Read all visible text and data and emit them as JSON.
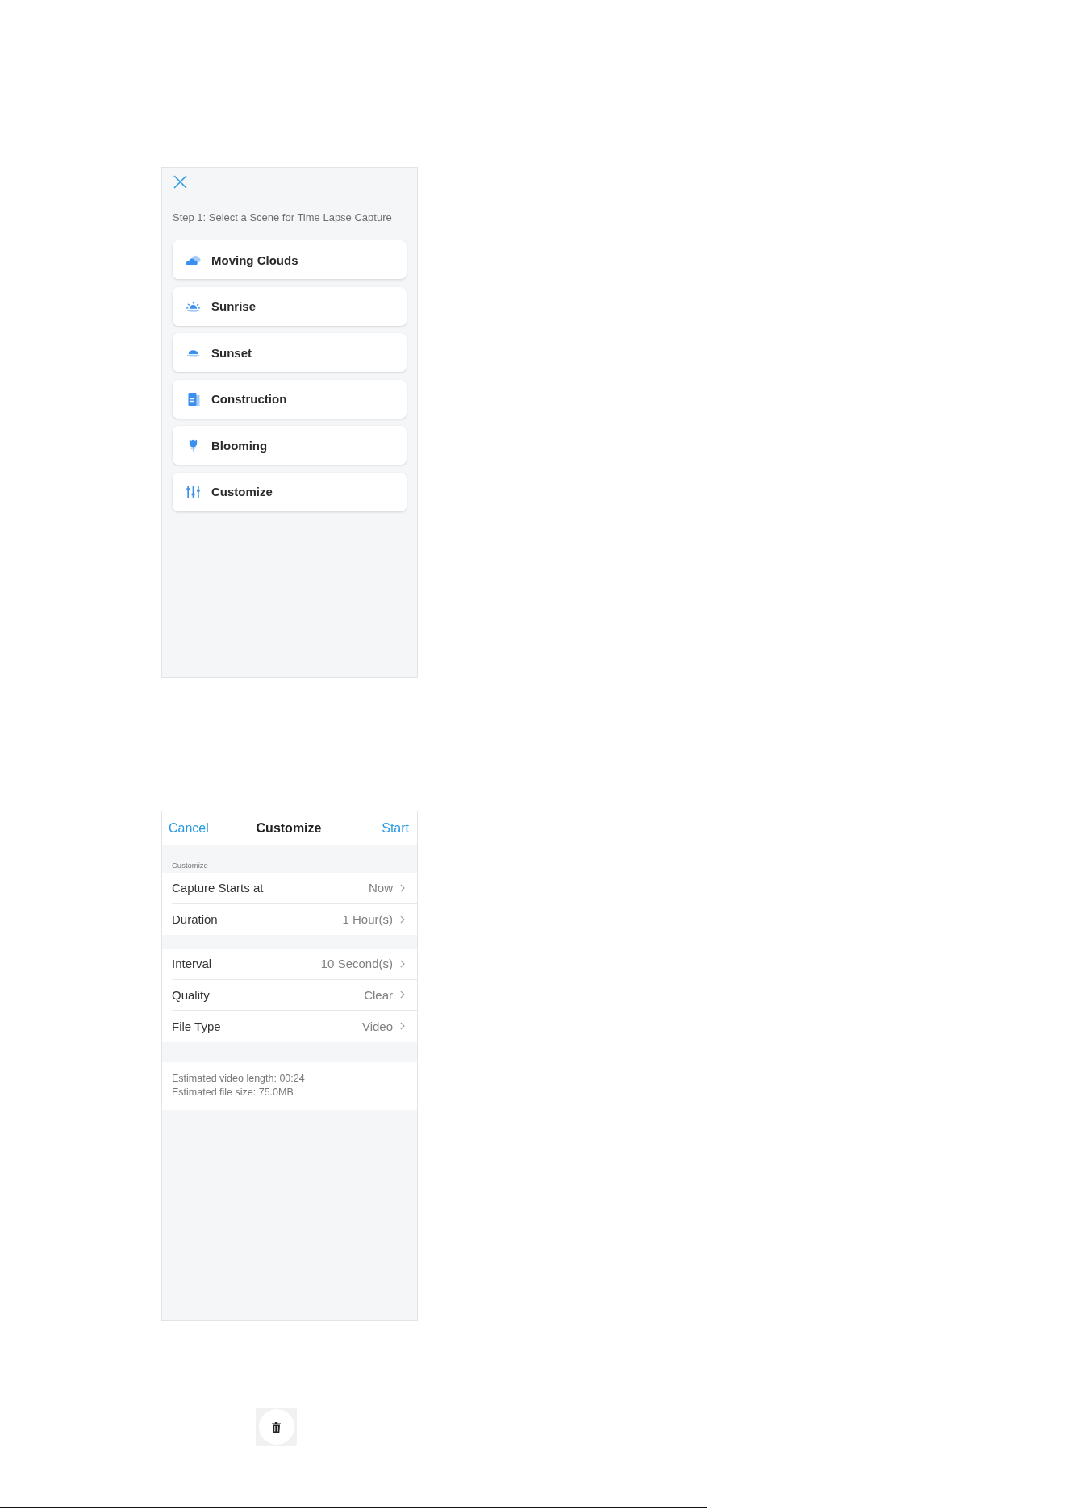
{
  "scene_screen": {
    "instruction": "Step 1: Select a Scene for Time Lapse Capture",
    "scenes": [
      {
        "kind": "clouds",
        "label": "Moving Clouds"
      },
      {
        "kind": "sunrise",
        "label": "Sunrise"
      },
      {
        "kind": "sunset",
        "label": "Sunset"
      },
      {
        "kind": "building",
        "label": "Construction"
      },
      {
        "kind": "flower",
        "label": "Blooming"
      },
      {
        "kind": "sliders",
        "label": "Customize"
      }
    ]
  },
  "customize_screen": {
    "header": {
      "cancel": "Cancel",
      "title": "Customize",
      "start": "Start"
    },
    "section_caption": "Customize",
    "groups": [
      {
        "rows": [
          {
            "label": "Capture Starts at",
            "value": "Now"
          },
          {
            "label": "Duration",
            "value": "1 Hour(s)"
          }
        ]
      },
      {
        "rows": [
          {
            "label": "Interval",
            "value": "10 Second(s)"
          },
          {
            "label": "Quality",
            "value": "Clear"
          },
          {
            "label": "File Type",
            "value": "Video"
          }
        ]
      }
    ],
    "estimates": [
      "Estimated video length: 00:24",
      "Estimated file size: 75.0MB"
    ]
  }
}
